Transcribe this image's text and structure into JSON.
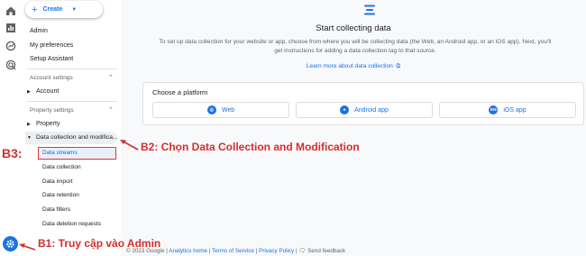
{
  "create_button": {
    "label": "Create"
  },
  "sidebar": {
    "admin": "Admin",
    "preferences": "My preferences",
    "setup_assistant": "Setup Assistant",
    "account_settings_header": "Account settings",
    "account": "Account",
    "property_settings_header": "Property settings",
    "property": "Property",
    "data_collection": "Data collection and modifica...",
    "sub_items": [
      "Data streams",
      "Data collection",
      "Data import",
      "Data retention",
      "Data filters",
      "Data deletion requests"
    ]
  },
  "main": {
    "title": "Start collecting data",
    "description": "To set up data collection for your website or app, choose from where you will be collecting data (the Web, an Android app, or an iOS app). Next, you'll get instructions for adding a data collection tag to that source.",
    "learn_more": "Learn more about data collection",
    "platform_card_title": "Choose a platform",
    "platforms": [
      "Web",
      "Android app",
      "iOS app"
    ]
  },
  "footer": {
    "copyright": "© 2023 Google |",
    "analytics_home": "Analytics home",
    "sep1": "|",
    "terms": "Terms of Service",
    "sep2": "|",
    "privacy": "Privacy Policy",
    "sep3": "|",
    "feedback": "Send feedback"
  },
  "annotations": {
    "b1": "B1: Truy cập vào Admin",
    "b2": "B2: Chọn Data Collection and Modification",
    "b3": "B3:"
  },
  "colors": {
    "accent": "#1a73e8",
    "annotation": "#d32f2f"
  }
}
